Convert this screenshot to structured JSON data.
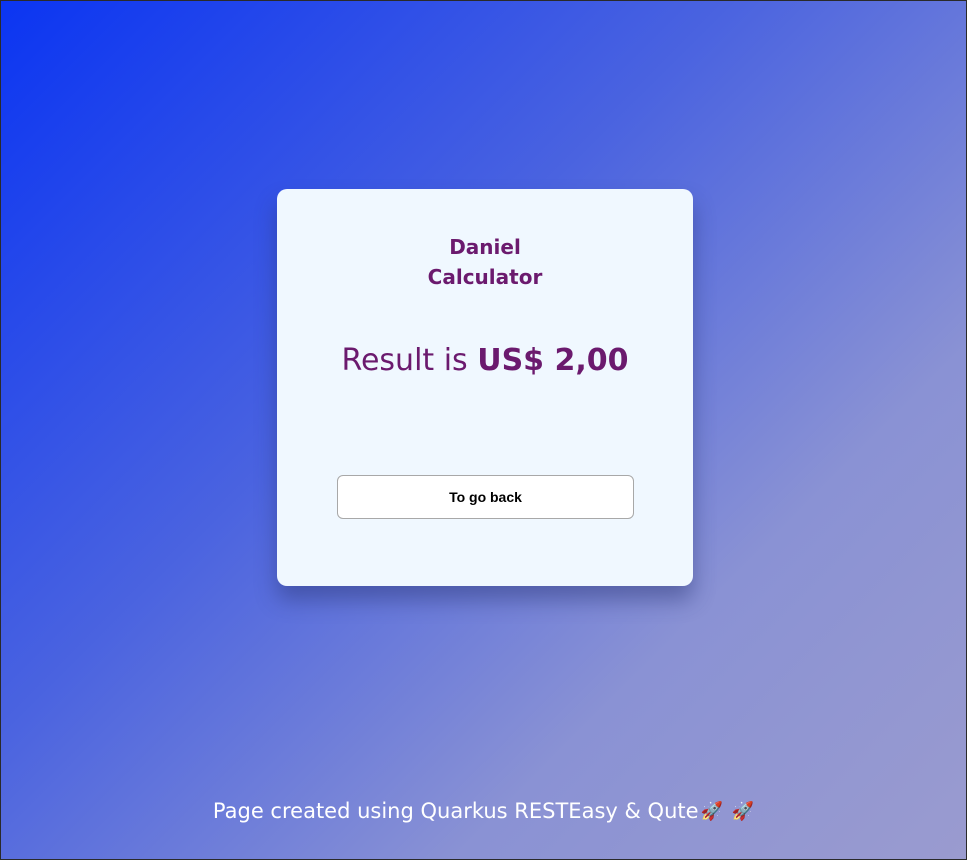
{
  "card": {
    "title_line1": "Daniel",
    "title_line2": "Calculator",
    "result_label": "Result is ",
    "result_value": "US$ 2,00",
    "back_button_label": "To go back"
  },
  "footer": {
    "text": "Page created using Quarkus RESTEasy & Qute",
    "icons": [
      "rocket-icon",
      "rocket-icon"
    ]
  },
  "colors": {
    "background_gradient": [
      "#0b35f2",
      "#9a9bcf"
    ],
    "card_background": "#f0f8ff",
    "accent_text": "#6b1a6e",
    "footer_text": "#ffffff"
  }
}
